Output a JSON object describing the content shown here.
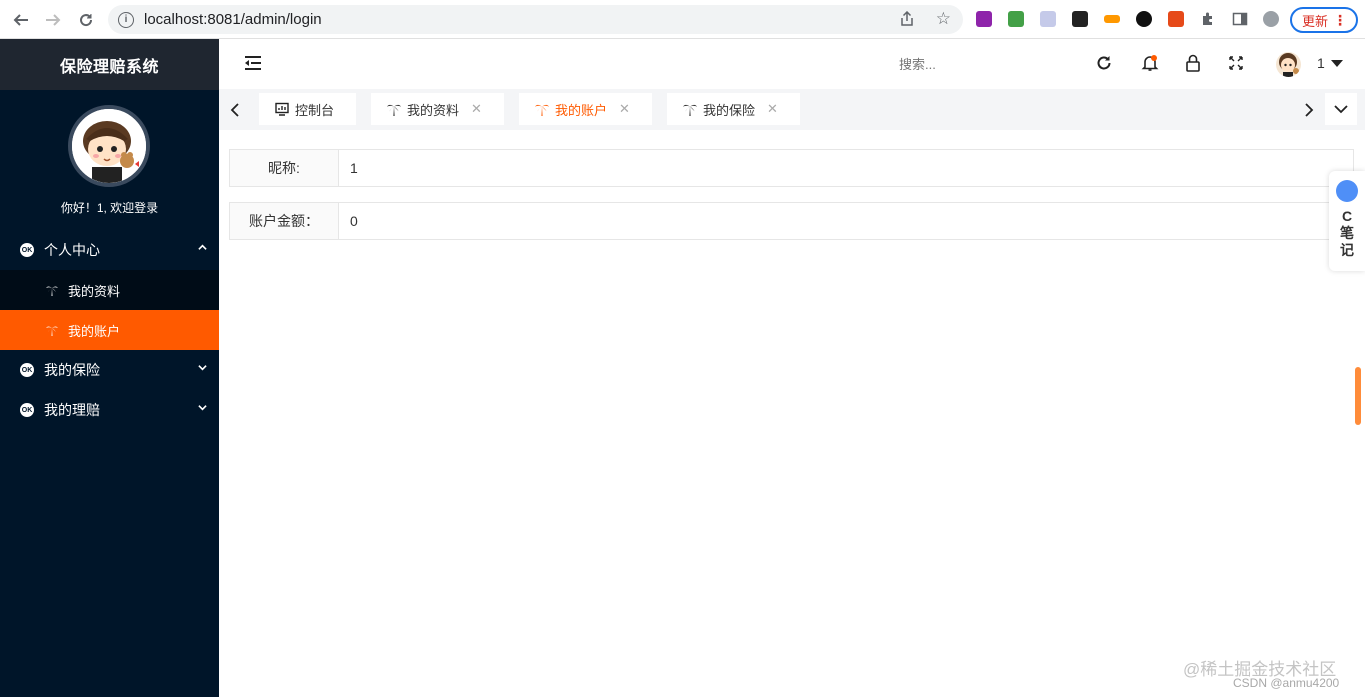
{
  "browser": {
    "url": "localhost:8081/admin/login",
    "update_label": "更新"
  },
  "sidebar": {
    "app_title": "保险理赔系统",
    "welcome": "你好！1, 欢迎登录",
    "menu": [
      {
        "label": "个人中心",
        "expanded": true,
        "children": [
          {
            "label": "我的资料",
            "active": false
          },
          {
            "label": "我的账户",
            "active": true
          }
        ]
      },
      {
        "label": "我的保险",
        "expanded": false
      },
      {
        "label": "我的理赔",
        "expanded": false
      }
    ],
    "ok_icon_text": "OK"
  },
  "header": {
    "search_placeholder": "搜索...",
    "username": "1"
  },
  "tabs": [
    {
      "label": "控制台",
      "closable": false,
      "active": false
    },
    {
      "label": "我的资料",
      "closable": true,
      "active": false
    },
    {
      "label": "我的账户",
      "closable": true,
      "active": true
    },
    {
      "label": "我的保险",
      "closable": true,
      "active": false
    }
  ],
  "form": {
    "nickname_label": "昵称:",
    "nickname_value": "1",
    "balance_label": "账户金额：",
    "balance_value": "0"
  },
  "note_widget": {
    "text": "C\n笔\n记"
  },
  "watermark": {
    "line1": "@稀土掘金技术社区",
    "line2": "CSDN @anmu4200"
  },
  "colors": {
    "sidebar_bg": "#001529",
    "accent": "#ff5a00"
  }
}
